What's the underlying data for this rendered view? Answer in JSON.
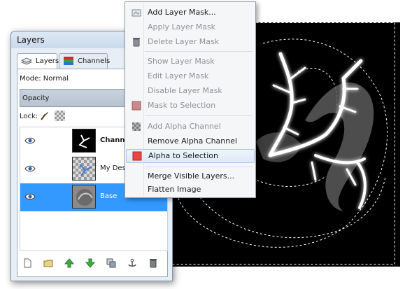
{
  "dock": {
    "title": "Layers",
    "tabs": [
      {
        "label": "Layers"
      },
      {
        "label": "Channels"
      }
    ],
    "mode_label": "Mode: Normal",
    "opacity_label": "Opacity",
    "lock_label": "Lock:",
    "layers": [
      {
        "name": "Channel",
        "bold": true,
        "visible": true,
        "selected": false
      },
      {
        "name": "My Desig",
        "bold": false,
        "visible": true,
        "selected": false
      },
      {
        "name": "Base",
        "bold": false,
        "visible": true,
        "selected": true
      }
    ],
    "footer_icons": [
      "new-layer-icon",
      "new-layer-group-icon",
      "raise-layer-icon",
      "lower-layer-icon",
      "duplicate-layer-icon",
      "anchor-layer-icon",
      "delete-layer-icon"
    ]
  },
  "menu": {
    "items": [
      {
        "label": "Add Layer Mask...",
        "enabled": true,
        "icon": "add-layer-mask-icon"
      },
      {
        "label": "Apply Layer Mask",
        "enabled": false,
        "icon": ""
      },
      {
        "label": "Delete Layer Mask",
        "enabled": false,
        "icon": "delete-icon"
      },
      {
        "label": "Show Layer Mask",
        "enabled": false,
        "icon": ""
      },
      {
        "label": "Edit Layer Mask",
        "enabled": false,
        "icon": ""
      },
      {
        "label": "Disable Layer Mask",
        "enabled": false,
        "icon": ""
      },
      {
        "label": "Mask to Selection",
        "enabled": false,
        "icon": "mask-to-selection-icon"
      },
      {
        "label": "Add Alpha Channel",
        "enabled": false,
        "icon": "alpha-channel-icon"
      },
      {
        "label": "Remove Alpha Channel",
        "enabled": true,
        "icon": ""
      },
      {
        "label": "Alpha to Selection",
        "enabled": true,
        "icon": "alpha-to-selection-icon",
        "hover": true
      },
      {
        "label": "Merge Visible Layers...",
        "enabled": true,
        "icon": ""
      },
      {
        "label": "Flatten Image",
        "enabled": true,
        "icon": ""
      }
    ]
  },
  "colors": {
    "selection_blue": "#3399ff",
    "menu_hover_border": "#a8c6ee",
    "canvas_background": "#000000"
  }
}
